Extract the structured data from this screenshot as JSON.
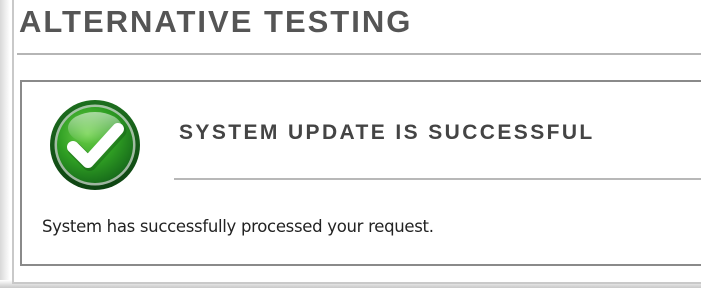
{
  "header": {
    "title": "ALTERNATIVE TESTING"
  },
  "status": {
    "icon": "check-circle-icon",
    "heading": "SYSTEM UPDATE IS SUCCESSFUL",
    "message": "System has successfully processed your request."
  },
  "colors": {
    "success_green": "#2e9a22",
    "title_text": "#555555"
  }
}
